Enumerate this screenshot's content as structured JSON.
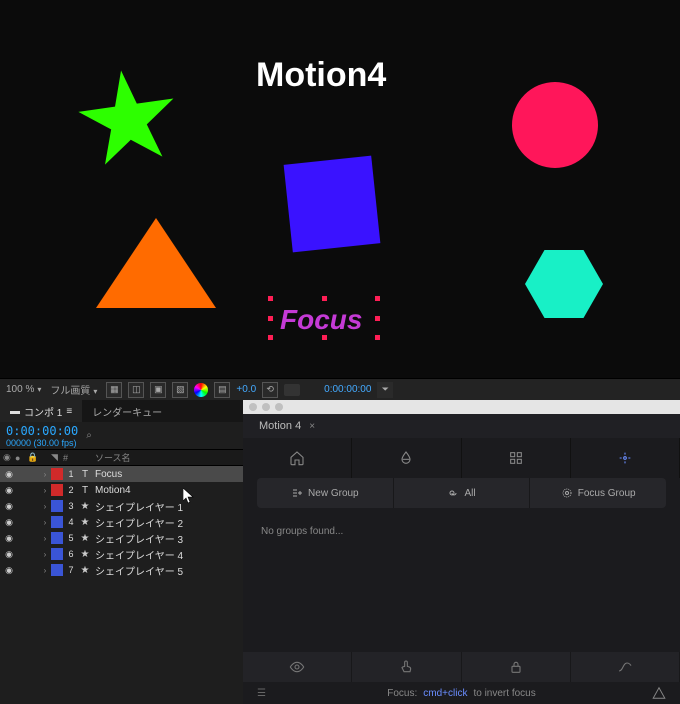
{
  "viewer": {
    "title_text": "Motion4",
    "focus_text": "Focus"
  },
  "viewer_bar": {
    "zoom": "100 %",
    "quality": "フル画質",
    "exposure": "+0.0",
    "timecode": "0:00:00:00"
  },
  "timeline": {
    "tab_active": "コンポ 1",
    "tab_queue": "レンダーキュー",
    "timecode": "0:00:00:00",
    "fps": "00000 (30.00 fps)",
    "search_placeholder": "⌕",
    "col_source": "ソース名",
    "layers": [
      {
        "num": "1",
        "color": "#d12a2a",
        "type": "T",
        "name": "Focus",
        "selected": true
      },
      {
        "num": "2",
        "color": "#d12a2a",
        "type": "T",
        "name": "Motion4",
        "selected": false
      },
      {
        "num": "3",
        "color": "#3a55d6",
        "type": "★",
        "name": "シェイプレイヤー 1",
        "selected": false
      },
      {
        "num": "4",
        "color": "#3a55d6",
        "type": "★",
        "name": "シェイプレイヤー 2",
        "selected": false
      },
      {
        "num": "5",
        "color": "#3a55d6",
        "type": "★",
        "name": "シェイプレイヤー 3",
        "selected": false
      },
      {
        "num": "6",
        "color": "#3a55d6",
        "type": "★",
        "name": "シェイプレイヤー 4",
        "selected": false
      },
      {
        "num": "7",
        "color": "#3a55d6",
        "type": "★",
        "name": "シェイプレイヤー 5",
        "selected": false
      }
    ]
  },
  "plugin": {
    "title": "Motion 4",
    "groups": {
      "new_group": "New Group",
      "all": "All",
      "focus_group": "Focus Group"
    },
    "empty_msg": "No groups found...",
    "hint_label": "Focus:",
    "hint_key": "cmd+click",
    "hint_rest": "to invert focus"
  }
}
